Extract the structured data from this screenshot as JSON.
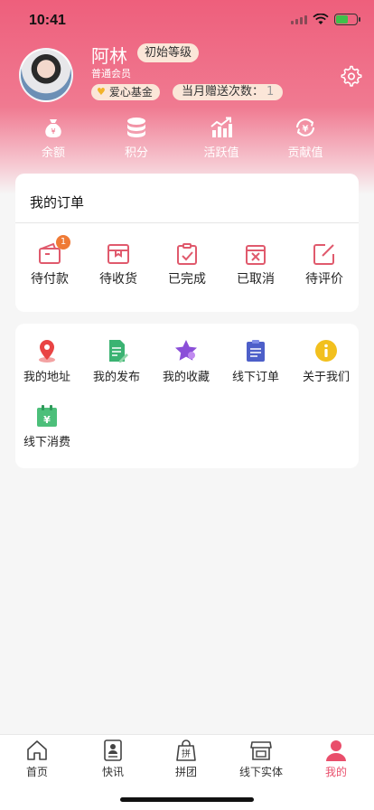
{
  "status_bar": {
    "time": "10:41"
  },
  "profile": {
    "name": "阿林",
    "level": "初始等级",
    "member_type": "普通会员",
    "fund_label": "爱心基金",
    "gift_label": "当月赠送次数：",
    "gift_count": "1"
  },
  "stats": [
    {
      "label": "余额",
      "icon": "money-bag-icon"
    },
    {
      "label": "积分",
      "icon": "coins-stack-icon"
    },
    {
      "label": "活跃值",
      "icon": "bar-chart-icon"
    },
    {
      "label": "贡献值",
      "icon": "yuan-cycle-icon"
    }
  ],
  "orders": {
    "title": "我的订单",
    "items": [
      {
        "label": "待付款",
        "icon": "wallet-icon",
        "badge": "1"
      },
      {
        "label": "待收货",
        "icon": "package-icon"
      },
      {
        "label": "已完成",
        "icon": "clipboard-check-icon"
      },
      {
        "label": "已取消",
        "icon": "cancel-icon"
      },
      {
        "label": "待评价",
        "icon": "edit-icon"
      }
    ]
  },
  "menu": {
    "items": [
      {
        "label": "我的地址",
        "icon": "location-pin-icon"
      },
      {
        "label": "我的发布",
        "icon": "document-edit-icon"
      },
      {
        "label": "我的收藏",
        "icon": "star-icon"
      },
      {
        "label": "线下订单",
        "icon": "clipboard-list-icon"
      },
      {
        "label": "关于我们",
        "icon": "info-icon"
      },
      {
        "label": "线下消费",
        "icon": "calendar-yuan-icon"
      }
    ]
  },
  "tabs": [
    {
      "label": "首页",
      "icon": "home-icon"
    },
    {
      "label": "快讯",
      "icon": "news-icon"
    },
    {
      "label": "拼团",
      "icon": "group-buy-bag-icon",
      "icon_text": "拼"
    },
    {
      "label": "线下实体",
      "icon": "store-icon"
    },
    {
      "label": "我的",
      "icon": "person-icon",
      "active": true
    }
  ],
  "colors": {
    "header": "#ee5f7c",
    "accent": "#e94e6b",
    "badge": "#fbe6d8",
    "order_icon": "#e05a6d"
  }
}
